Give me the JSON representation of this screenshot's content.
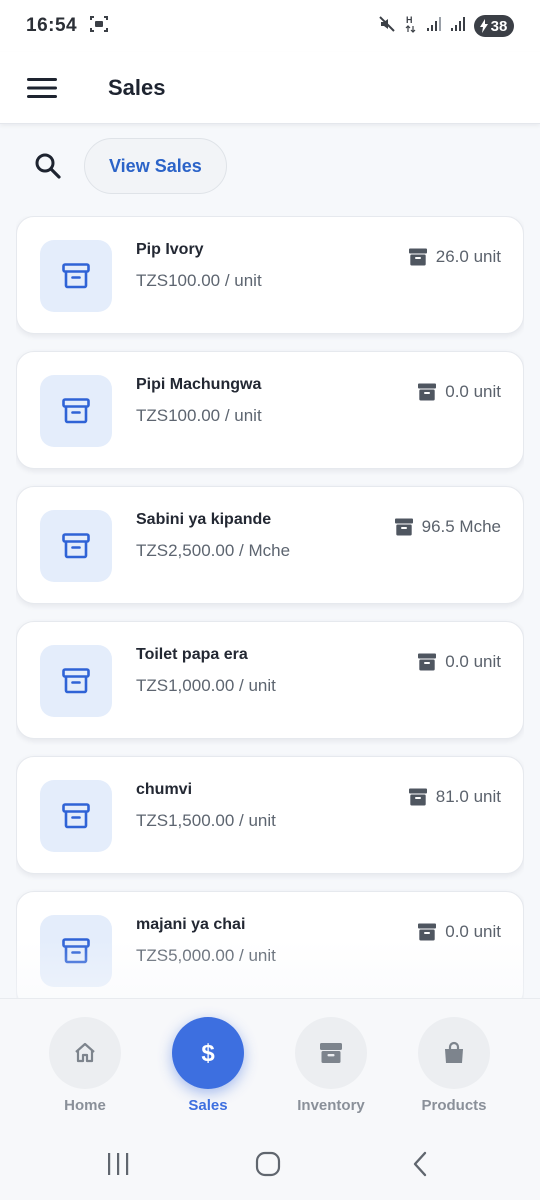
{
  "status_bar": {
    "time": "16:54",
    "battery": "38",
    "icons": [
      "screenshot-icon",
      "mute-icon",
      "signal-h-icon",
      "signal-icon",
      "signal-icon",
      "battery-charging-icon"
    ]
  },
  "app_bar": {
    "title": "Sales",
    "menu_icon": "hamburger-menu-icon"
  },
  "toolbar": {
    "search_icon": "search-icon",
    "view_sales_label": "View Sales"
  },
  "products": [
    {
      "name": "Pip Ivory",
      "price": "TZS100.00 / unit",
      "stock": "26.0 unit",
      "icon": "archive-box-icon"
    },
    {
      "name": "Pipi Machungwa",
      "price": "TZS100.00 / unit",
      "stock": "0.0 unit",
      "icon": "archive-box-icon"
    },
    {
      "name": "Sabini ya kipande",
      "price": "TZS2,500.00 / Mche",
      "stock": "96.5 Mche",
      "icon": "archive-box-icon"
    },
    {
      "name": "Toilet papa era",
      "price": "TZS1,000.00 / unit",
      "stock": "0.0 unit",
      "icon": "archive-box-icon"
    },
    {
      "name": "chumvi",
      "price": "TZS1,500.00 / unit",
      "stock": "81.0 unit",
      "icon": "archive-box-icon"
    },
    {
      "name": "majani ya chai",
      "price": "TZS5,000.00 / unit",
      "stock": "0.0 unit",
      "icon": "archive-box-icon"
    }
  ],
  "bottom_nav": {
    "items": [
      {
        "label": "Home",
        "icon": "home-icon",
        "active": false
      },
      {
        "label": "Sales",
        "icon": "dollar-icon",
        "active": true
      },
      {
        "label": "Inventory",
        "icon": "inventory-box-icon",
        "active": false
      },
      {
        "label": "Products",
        "icon": "shopping-bag-icon",
        "active": false
      }
    ]
  },
  "colors": {
    "accent": "#3d6fe0",
    "link": "#2b63c8",
    "icon_tile": "#e4edfb",
    "muted_text": "#5d6570"
  }
}
